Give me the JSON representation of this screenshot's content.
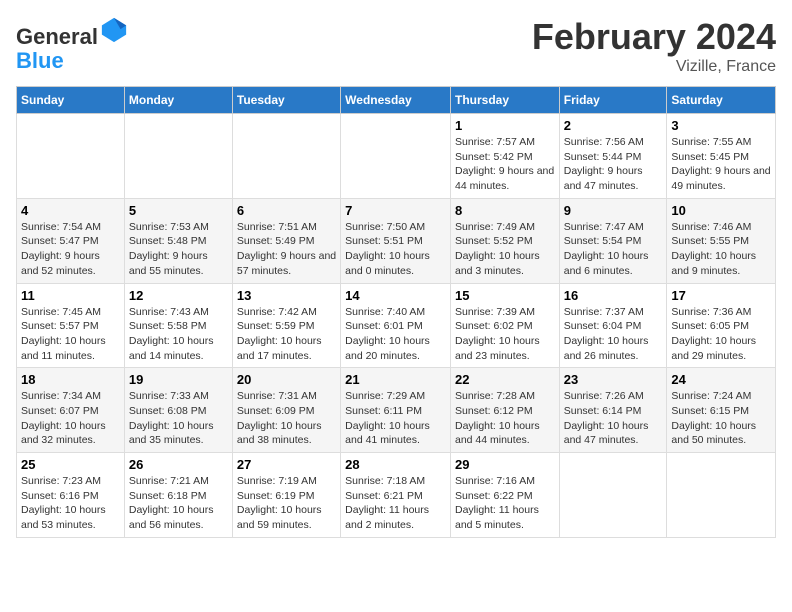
{
  "header": {
    "logo_general": "General",
    "logo_blue": "Blue",
    "main_title": "February 2024",
    "subtitle": "Vizille, France"
  },
  "weekdays": [
    "Sunday",
    "Monday",
    "Tuesday",
    "Wednesday",
    "Thursday",
    "Friday",
    "Saturday"
  ],
  "weeks": [
    [
      {
        "day": "",
        "sunrise": "",
        "sunset": "",
        "daylight": ""
      },
      {
        "day": "",
        "sunrise": "",
        "sunset": "",
        "daylight": ""
      },
      {
        "day": "",
        "sunrise": "",
        "sunset": "",
        "daylight": ""
      },
      {
        "day": "",
        "sunrise": "",
        "sunset": "",
        "daylight": ""
      },
      {
        "day": "1",
        "sunrise": "Sunrise: 7:57 AM",
        "sunset": "Sunset: 5:42 PM",
        "daylight": "Daylight: 9 hours and 44 minutes."
      },
      {
        "day": "2",
        "sunrise": "Sunrise: 7:56 AM",
        "sunset": "Sunset: 5:44 PM",
        "daylight": "Daylight: 9 hours and 47 minutes."
      },
      {
        "day": "3",
        "sunrise": "Sunrise: 7:55 AM",
        "sunset": "Sunset: 5:45 PM",
        "daylight": "Daylight: 9 hours and 49 minutes."
      }
    ],
    [
      {
        "day": "4",
        "sunrise": "Sunrise: 7:54 AM",
        "sunset": "Sunset: 5:47 PM",
        "daylight": "Daylight: 9 hours and 52 minutes."
      },
      {
        "day": "5",
        "sunrise": "Sunrise: 7:53 AM",
        "sunset": "Sunset: 5:48 PM",
        "daylight": "Daylight: 9 hours and 55 minutes."
      },
      {
        "day": "6",
        "sunrise": "Sunrise: 7:51 AM",
        "sunset": "Sunset: 5:49 PM",
        "daylight": "Daylight: 9 hours and 57 minutes."
      },
      {
        "day": "7",
        "sunrise": "Sunrise: 7:50 AM",
        "sunset": "Sunset: 5:51 PM",
        "daylight": "Daylight: 10 hours and 0 minutes."
      },
      {
        "day": "8",
        "sunrise": "Sunrise: 7:49 AM",
        "sunset": "Sunset: 5:52 PM",
        "daylight": "Daylight: 10 hours and 3 minutes."
      },
      {
        "day": "9",
        "sunrise": "Sunrise: 7:47 AM",
        "sunset": "Sunset: 5:54 PM",
        "daylight": "Daylight: 10 hours and 6 minutes."
      },
      {
        "day": "10",
        "sunrise": "Sunrise: 7:46 AM",
        "sunset": "Sunset: 5:55 PM",
        "daylight": "Daylight: 10 hours and 9 minutes."
      }
    ],
    [
      {
        "day": "11",
        "sunrise": "Sunrise: 7:45 AM",
        "sunset": "Sunset: 5:57 PM",
        "daylight": "Daylight: 10 hours and 11 minutes."
      },
      {
        "day": "12",
        "sunrise": "Sunrise: 7:43 AM",
        "sunset": "Sunset: 5:58 PM",
        "daylight": "Daylight: 10 hours and 14 minutes."
      },
      {
        "day": "13",
        "sunrise": "Sunrise: 7:42 AM",
        "sunset": "Sunset: 5:59 PM",
        "daylight": "Daylight: 10 hours and 17 minutes."
      },
      {
        "day": "14",
        "sunrise": "Sunrise: 7:40 AM",
        "sunset": "Sunset: 6:01 PM",
        "daylight": "Daylight: 10 hours and 20 minutes."
      },
      {
        "day": "15",
        "sunrise": "Sunrise: 7:39 AM",
        "sunset": "Sunset: 6:02 PM",
        "daylight": "Daylight: 10 hours and 23 minutes."
      },
      {
        "day": "16",
        "sunrise": "Sunrise: 7:37 AM",
        "sunset": "Sunset: 6:04 PM",
        "daylight": "Daylight: 10 hours and 26 minutes."
      },
      {
        "day": "17",
        "sunrise": "Sunrise: 7:36 AM",
        "sunset": "Sunset: 6:05 PM",
        "daylight": "Daylight: 10 hours and 29 minutes."
      }
    ],
    [
      {
        "day": "18",
        "sunrise": "Sunrise: 7:34 AM",
        "sunset": "Sunset: 6:07 PM",
        "daylight": "Daylight: 10 hours and 32 minutes."
      },
      {
        "day": "19",
        "sunrise": "Sunrise: 7:33 AM",
        "sunset": "Sunset: 6:08 PM",
        "daylight": "Daylight: 10 hours and 35 minutes."
      },
      {
        "day": "20",
        "sunrise": "Sunrise: 7:31 AM",
        "sunset": "Sunset: 6:09 PM",
        "daylight": "Daylight: 10 hours and 38 minutes."
      },
      {
        "day": "21",
        "sunrise": "Sunrise: 7:29 AM",
        "sunset": "Sunset: 6:11 PM",
        "daylight": "Daylight: 10 hours and 41 minutes."
      },
      {
        "day": "22",
        "sunrise": "Sunrise: 7:28 AM",
        "sunset": "Sunset: 6:12 PM",
        "daylight": "Daylight: 10 hours and 44 minutes."
      },
      {
        "day": "23",
        "sunrise": "Sunrise: 7:26 AM",
        "sunset": "Sunset: 6:14 PM",
        "daylight": "Daylight: 10 hours and 47 minutes."
      },
      {
        "day": "24",
        "sunrise": "Sunrise: 7:24 AM",
        "sunset": "Sunset: 6:15 PM",
        "daylight": "Daylight: 10 hours and 50 minutes."
      }
    ],
    [
      {
        "day": "25",
        "sunrise": "Sunrise: 7:23 AM",
        "sunset": "Sunset: 6:16 PM",
        "daylight": "Daylight: 10 hours and 53 minutes."
      },
      {
        "day": "26",
        "sunrise": "Sunrise: 7:21 AM",
        "sunset": "Sunset: 6:18 PM",
        "daylight": "Daylight: 10 hours and 56 minutes."
      },
      {
        "day": "27",
        "sunrise": "Sunrise: 7:19 AM",
        "sunset": "Sunset: 6:19 PM",
        "daylight": "Daylight: 10 hours and 59 minutes."
      },
      {
        "day": "28",
        "sunrise": "Sunrise: 7:18 AM",
        "sunset": "Sunset: 6:21 PM",
        "daylight": "Daylight: 11 hours and 2 minutes."
      },
      {
        "day": "29",
        "sunrise": "Sunrise: 7:16 AM",
        "sunset": "Sunset: 6:22 PM",
        "daylight": "Daylight: 11 hours and 5 minutes."
      },
      {
        "day": "",
        "sunrise": "",
        "sunset": "",
        "daylight": ""
      },
      {
        "day": "",
        "sunrise": "",
        "sunset": "",
        "daylight": ""
      }
    ]
  ]
}
